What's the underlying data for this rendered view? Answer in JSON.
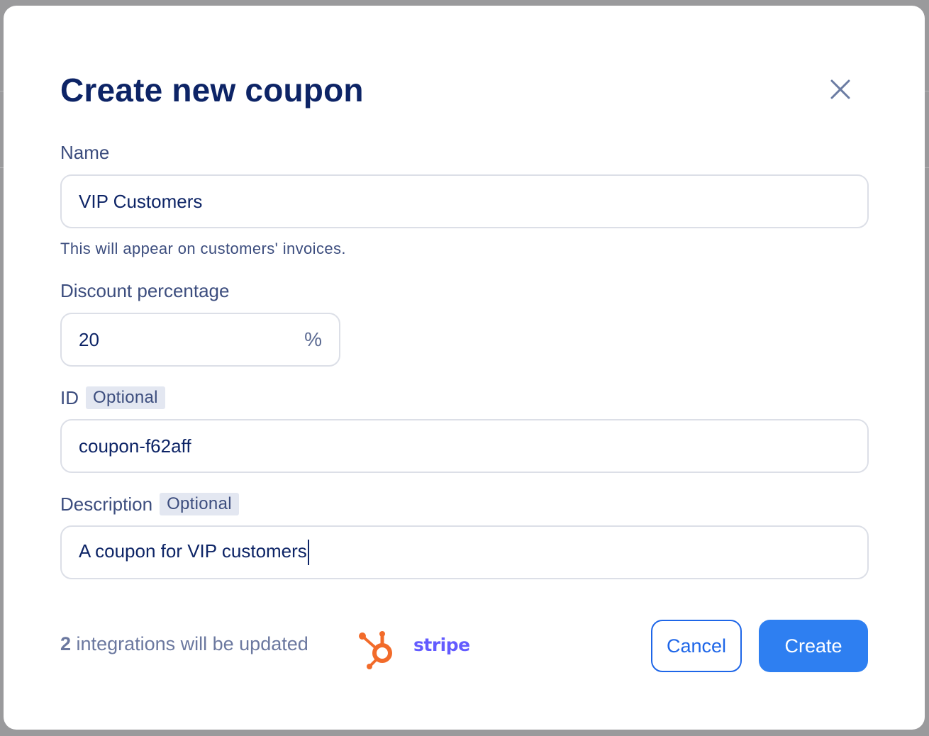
{
  "dialog": {
    "title": "Create new coupon",
    "close_icon": "close-icon"
  },
  "fields": {
    "name": {
      "label": "Name",
      "value": "VIP Customers",
      "hint": "This will appear on customers' invoices."
    },
    "discount": {
      "label": "Discount percentage",
      "value": "20",
      "suffix": "%"
    },
    "id": {
      "label": "ID",
      "badge": "Optional",
      "value": "coupon-f62aff"
    },
    "description": {
      "label": "Description",
      "badge": "Optional",
      "value": "A coupon for VIP customers"
    }
  },
  "footer": {
    "integration_count": "2",
    "integration_text": "integrations will be updated",
    "integrations": [
      "hubspot-icon",
      "stripe-logo"
    ],
    "stripe_label": "stripe",
    "cancel_label": "Cancel",
    "create_label": "Create"
  },
  "colors": {
    "primary": "#2e7ff1",
    "title": "#0d2466",
    "hubspot": "#f26b2a",
    "stripe": "#635bff"
  }
}
